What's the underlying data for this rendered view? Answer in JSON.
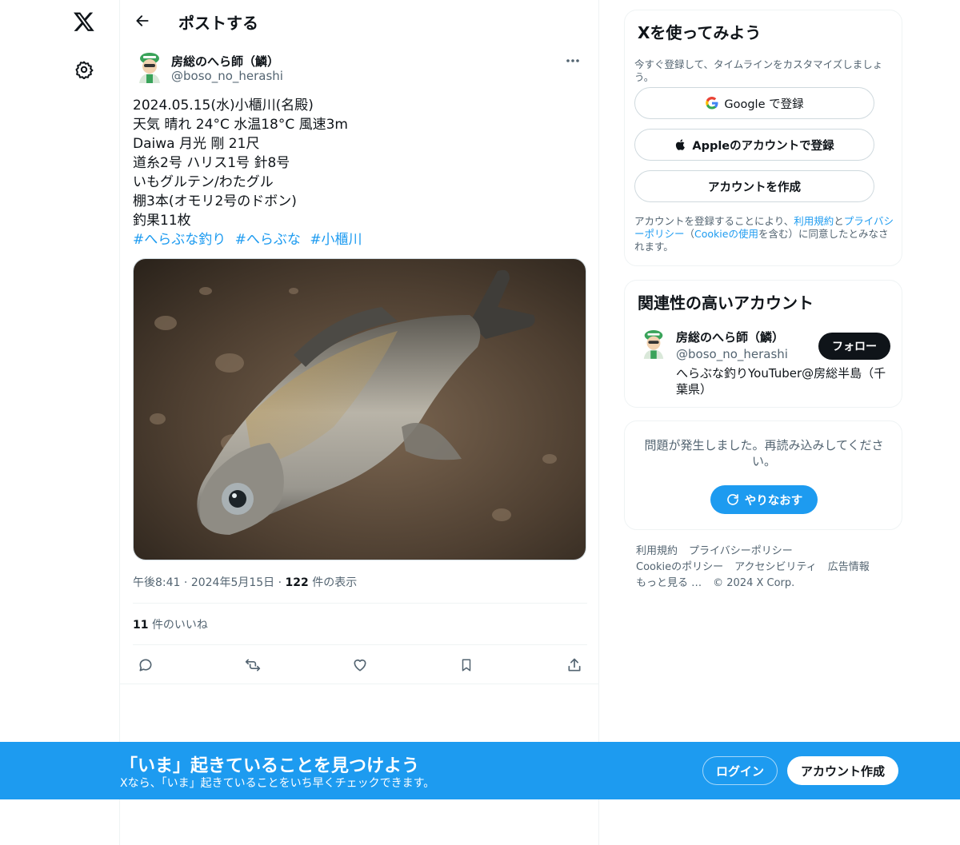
{
  "nav": {
    "logo_icon": "x-logo-icon",
    "settings_icon": "gear-icon"
  },
  "header": {
    "title": "ポストする",
    "back_icon": "arrow-left-icon"
  },
  "tweet": {
    "author_name": "房総のへら師（鱗）",
    "author_handle": "@boso_no_herashi",
    "lines": [
      "2024.05.15(水)小櫃川(名殿)",
      "天気 晴れ 24°C 水温18°C 風速3m",
      "Daiwa 月光 剛 21尺",
      "道糸2号 ハリス1号 針8号",
      "いもグルテン/わたグル",
      "棚3本(オモリ2号のドボン)",
      "釣果11枚"
    ],
    "hashtags": [
      "#へらぶな釣り",
      "#へらぶな",
      "#小櫃川"
    ],
    "time": "午後8:41",
    "date": "2024年5月15日",
    "views_count": "122",
    "views_label": "件の表示",
    "likes_count": "11",
    "likes_label": "件のいいね",
    "image_alt": "fish-photo"
  },
  "sidebar": {
    "signup": {
      "title": "Xを使ってみよう",
      "subtitle": "今すぐ登録して、タイムラインをカスタマイズしましょう。",
      "google_label": "Google で登録",
      "apple_label": "Appleのアカウントで登録",
      "create_label": "アカウントを作成",
      "legal_prefix": "アカウントを登録することにより、",
      "terms": "利用規約",
      "and": "と",
      "privacy": "プライバシーポリシー",
      "cookie_open": "（",
      "cookie": "Cookieの使用",
      "legal_suffix": "を含む）に同意したとみなされます。"
    },
    "related": {
      "title": "関連性の高いアカウント",
      "name": "房総のへら師（鱗）",
      "handle": "@boso_no_herashi",
      "bio": "へらぶな釣りYouTuber@房総半島（千葉県）",
      "follow_label": "フォロー"
    },
    "error": {
      "message": "問題が発生しました。再読み込みしてください。",
      "retry_label": "やりなおす"
    },
    "footer": [
      "利用規約",
      "プライバシーポリシー",
      "Cookieのポリシー",
      "アクセシビリティ",
      "広告情報",
      "もっと見る …",
      "© 2024 X Corp."
    ]
  },
  "banner": {
    "title": "「いま」起きていることを見つけよう",
    "subtitle": "Xなら、「いま」起きていることをいち早くチェックできます。",
    "login_label": "ログイン",
    "create_label": "アカウント作成"
  },
  "colors": {
    "accent": "#1d9bf0",
    "text": "#0f1419",
    "muted": "#536471"
  }
}
